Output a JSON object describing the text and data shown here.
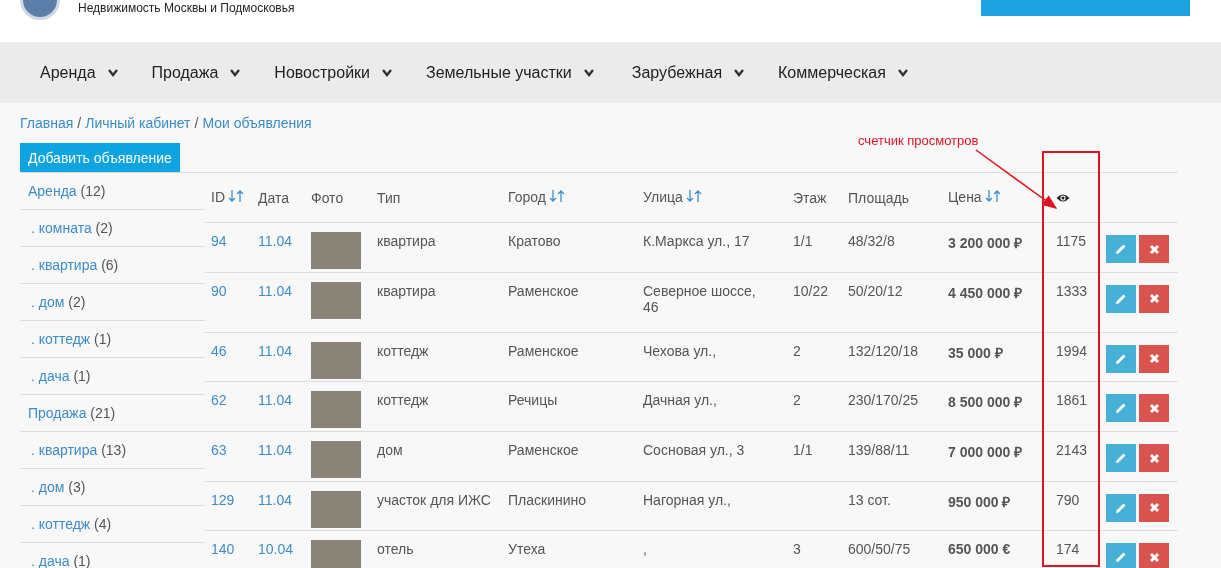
{
  "header": {
    "tagline": "Недвижимость Москвы и Подмосковья"
  },
  "nav": [
    {
      "label": "Аренда"
    },
    {
      "label": "Продажа"
    },
    {
      "label": "Новостройки"
    },
    {
      "label": "Земельные участки"
    },
    {
      "label": "Зарубежная"
    },
    {
      "label": "Коммерческая"
    }
  ],
  "breadcrumbs": [
    {
      "kind": "link",
      "text": "Главная"
    },
    {
      "kind": "separator",
      "text": "/"
    },
    {
      "kind": "link",
      "text": "Личный кабинет"
    },
    {
      "kind": "separator",
      "text": "/"
    },
    {
      "kind": "link",
      "text": "Мои объявления"
    }
  ],
  "add_button": "Добавить объявление",
  "sidebar": {
    "items": [
      {
        "label": "Аренда",
        "count": "(12)",
        "children": [
          {
            "label": ". комната",
            "count": "(2)"
          },
          {
            "label": ". квартира",
            "count": "(6)"
          },
          {
            "label": ". дом",
            "count": "(2)"
          },
          {
            "label": ". коттедж",
            "count": "(1)"
          },
          {
            "label": ". дача",
            "count": "(1)"
          }
        ]
      },
      {
        "label": "Продажа",
        "count": "(21)",
        "children": [
          {
            "label": ". квартира",
            "count": "(13)"
          },
          {
            "label": ". дом",
            "count": "(3)"
          },
          {
            "label": ". коттедж",
            "count": "(4)"
          },
          {
            "label": ". дача",
            "count": "(1)"
          }
        ]
      }
    ]
  },
  "table": {
    "columns": [
      {
        "kind": "text",
        "label": "ID",
        "sortable": true
      },
      {
        "kind": "text",
        "label": "Дата",
        "sortable": false
      },
      {
        "kind": "text",
        "label": "Фото",
        "sortable": false
      },
      {
        "kind": "text",
        "label": "Тип",
        "sortable": false
      },
      {
        "kind": "text",
        "label": "Город",
        "sortable": true
      },
      {
        "kind": "text",
        "label": "Улица",
        "sortable": true
      },
      {
        "kind": "text",
        "label": "Этаж",
        "sortable": false
      },
      {
        "kind": "text",
        "label": "Площадь",
        "sortable": false
      },
      {
        "kind": "text",
        "label": "Цена",
        "sortable": true
      },
      {
        "kind": "views"
      }
    ],
    "rows": [
      {
        "id": "94",
        "date": "11.04",
        "type": "квартира",
        "city": "Кратово",
        "street": "К.Маркса ул., 17",
        "floor": "1/1",
        "area": "48/32/8",
        "price": "3 200 000 ₽",
        "views": "1175"
      },
      {
        "id": "90",
        "date": "11.04",
        "type": "квартира",
        "city": "Раменское",
        "street": "Северное шоссе, 46",
        "floor": "10/22",
        "area": "50/20/12",
        "price": "4 450 000 ₽",
        "views": "1333"
      },
      {
        "id": "46",
        "date": "11.04",
        "type": "коттедж",
        "city": "Раменское",
        "street": "Чехова ул.,",
        "floor": "2",
        "area": "132/120/18",
        "price": "35 000 ₽",
        "views": "1994"
      },
      {
        "id": "62",
        "date": "11.04",
        "type": "коттедж",
        "city": "Речицы",
        "street": "Дачная ул.,",
        "floor": "2",
        "area": "230/170/25",
        "price": "8 500 000 ₽",
        "views": "1861"
      },
      {
        "id": "63",
        "date": "11.04",
        "type": "дом",
        "city": "Раменское",
        "street": "Сосновая ул., 3",
        "floor": "1/1",
        "area": "139/88/11",
        "price": "7 000 000 ₽",
        "views": "2143"
      },
      {
        "id": "129",
        "date": "11.04",
        "type": "участок для ИЖС",
        "city": "Пласкинино",
        "street": "Нагорная ул.,",
        "area": "13 сот.",
        "price": "950 000 ₽",
        "views": "790"
      },
      {
        "id": "140",
        "date": "10.04",
        "type": "отель",
        "city": "Утеха",
        "street": ",",
        "floor": "3",
        "area": "600/50/75",
        "price": "650 000 €",
        "views": "174"
      }
    ]
  },
  "annotation": {
    "text": "счетчик просмотров"
  }
}
